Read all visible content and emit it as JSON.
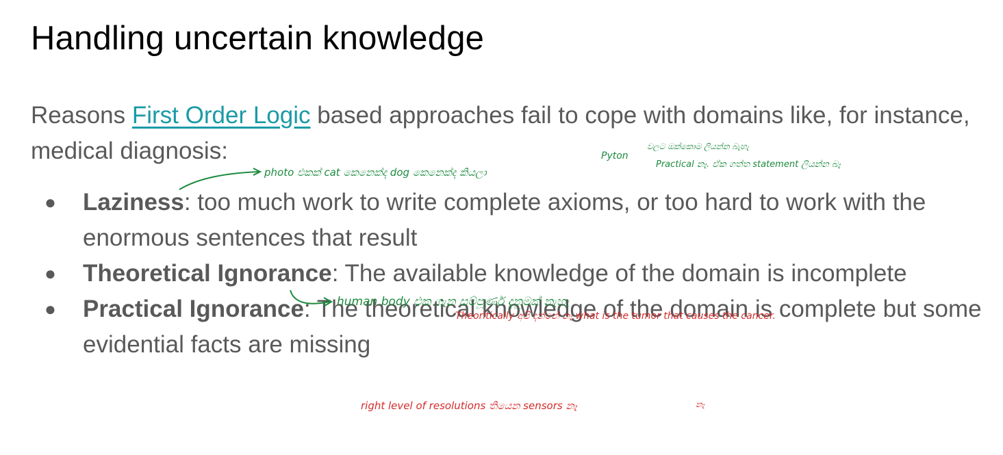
{
  "title": "Handling uncertain knowledge",
  "intro": {
    "before_link": "Reasons ",
    "link": "First Order Logic",
    "after_link": " based approaches fail to cope with domains like, for instance, medical diagnosis:"
  },
  "bullets": [
    {
      "term": "Laziness",
      "text": ": too much work to write complete axioms, or too hard to work with the enormous sentences that result"
    },
    {
      "term": "Theoretical Ignorance",
      "text": ": The available knowledge of the domain is incomplete"
    },
    {
      "term": "Practical Ignorance",
      "text": ": The theoretical knowledge of the domain is complete but some evidential facts are missing"
    }
  ],
  "bullet_glyph": "●",
  "annotations": {
    "colors": {
      "green": "#1d8a3e",
      "red": "#d42a2a"
    },
    "note_photo": "photo එකක් cat කෙනෙක්ද dog කෙනෙක්ද කියලා",
    "note_python": "Pyton",
    "note_python_extra": "වලට ඔක්කොම ලියන්න බැහැ",
    "note_practical": "Practical නෑ. ඒක ගත්ත statement ලියන්න බෑ",
    "note_human_body": "human body එක ගැන සම්පූර්ණ දැනුමක් නැහැ",
    "note_theoretically": "Theoritically අපි දන්නේ නෑ what is the tumor that causes the cancer.",
    "note_resolution": "right level of resolutions තියෙන sensors නෑ",
    "note_resolution_extra": "නෑ"
  }
}
